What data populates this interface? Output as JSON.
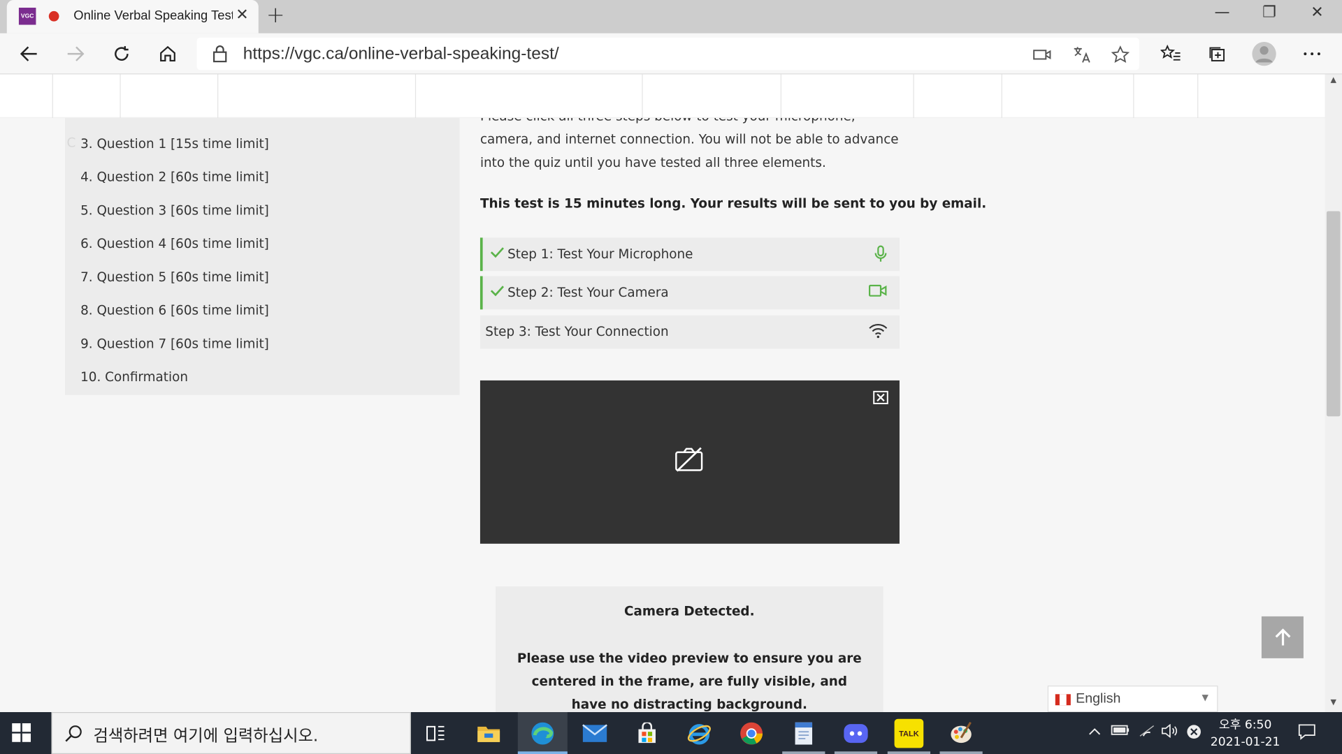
{
  "browser": {
    "tab": {
      "favicon_text": "VGC",
      "title": "Online Verbal Speaking Test",
      "close": "✕"
    },
    "new_tab": "+",
    "window_controls": {
      "minimize": "—",
      "restore": "❐",
      "close": "✕"
    },
    "url": "https://vgc.ca/online-verbal-speaking-test/"
  },
  "sidebar": {
    "ghost_text": "C",
    "items": [
      "3. Question 1 [15s time limit]",
      "4. Question 2 [60s time limit]",
      "5. Question 3 [60s time limit]",
      "6. Question 4 [60s time limit]",
      "7. Question 5 [60s time limit]",
      "8. Question 6 [60s time limit]",
      "9. Question 7 [60s time limit]",
      "10. Confirmation"
    ]
  },
  "main": {
    "intro": "Please click all three steps below to test your microphone, camera, and internet connection. You will not be able to advance into the quiz until you have tested all three elements.",
    "notice": "This test is 15 minutes long. Your results will be sent to you by email.",
    "steps": [
      {
        "label": "Step 1: Test Your Microphone",
        "done": true
      },
      {
        "label": "Step 2: Test Your Camera",
        "done": true
      },
      {
        "label": "Step 3: Test Your Connection",
        "done": false
      }
    ],
    "detect_title": "Camera Detected.",
    "detect_text": "Please use the video preview to ensure you are centered in the frame, are fully visible, and have no distracting background."
  },
  "language": {
    "selected": "English",
    "caret": "▼"
  },
  "taskbar": {
    "search_placeholder": "검색하려면 여기에 입력하십시오.",
    "talk_label": "TALK",
    "clock_time": "오후 6:50",
    "clock_date": "2021-01-21"
  },
  "colors": {
    "accent_green": "#5ab349",
    "camera_bg": "#333333",
    "tab_favicon": "#7b2c8f"
  }
}
